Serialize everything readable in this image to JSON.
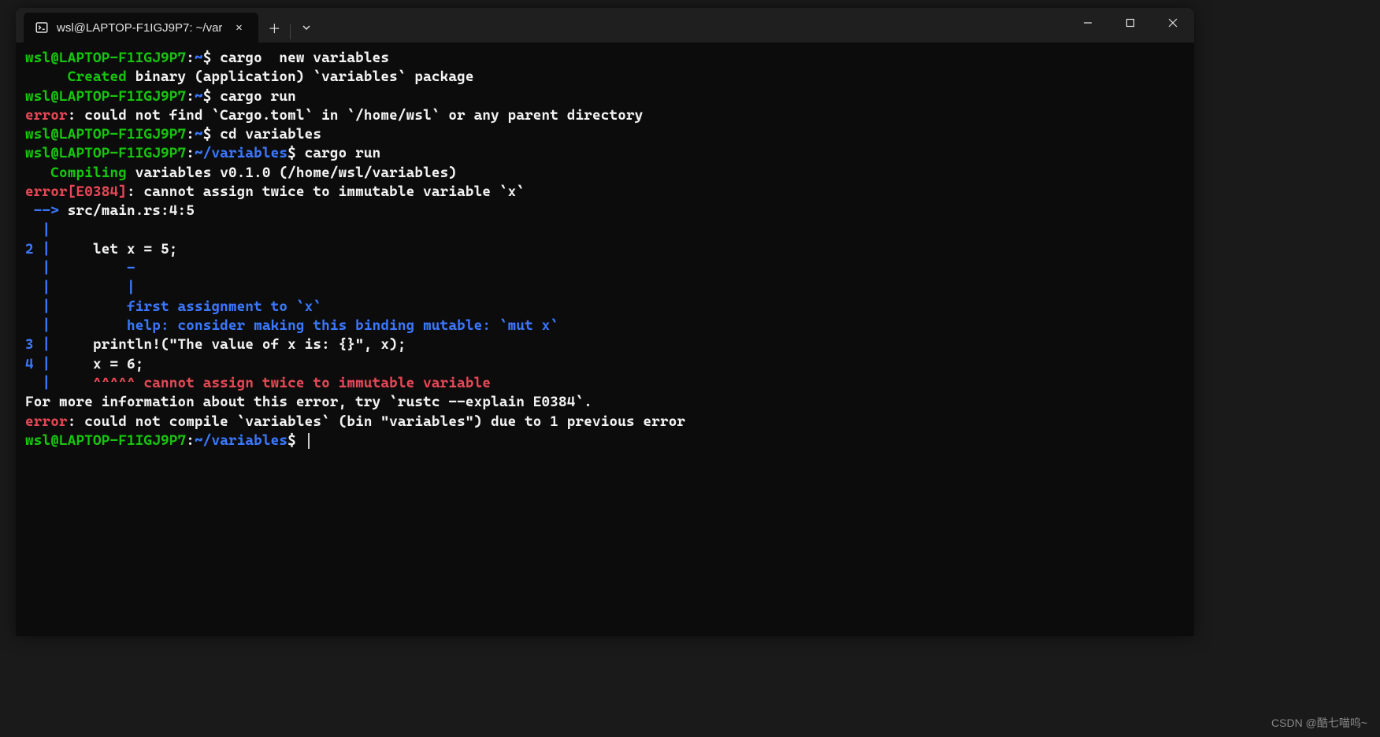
{
  "tab": {
    "title": "wsl@LAPTOP-F1IGJ9P7: ~/var"
  },
  "lines": [
    {
      "segments": [
        {
          "cls": "green",
          "t": "wsl@LAPTOP-F1IGJ9P7"
        },
        {
          "cls": "white",
          "t": ":"
        },
        {
          "cls": "blue",
          "t": "~"
        },
        {
          "cls": "white",
          "t": "$ cargo  new variables"
        }
      ]
    },
    {
      "segments": [
        {
          "cls": "white",
          "t": "     "
        },
        {
          "cls": "green",
          "t": "Created"
        },
        {
          "cls": "white",
          "t": " binary (application) `variables` package"
        }
      ]
    },
    {
      "segments": [
        {
          "cls": "green",
          "t": "wsl@LAPTOP-F1IGJ9P7"
        },
        {
          "cls": "white",
          "t": ":"
        },
        {
          "cls": "blue",
          "t": "~"
        },
        {
          "cls": "white",
          "t": "$ cargo run"
        }
      ]
    },
    {
      "segments": [
        {
          "cls": "red",
          "t": "error"
        },
        {
          "cls": "white",
          "t": ": could not find `Cargo.toml` in `/home/wsl` or any parent directory"
        }
      ]
    },
    {
      "segments": [
        {
          "cls": "green",
          "t": "wsl@LAPTOP-F1IGJ9P7"
        },
        {
          "cls": "white",
          "t": ":"
        },
        {
          "cls": "blue",
          "t": "~"
        },
        {
          "cls": "white",
          "t": "$ cd variables"
        }
      ]
    },
    {
      "segments": [
        {
          "cls": "green",
          "t": "wsl@LAPTOP-F1IGJ9P7"
        },
        {
          "cls": "white",
          "t": ":"
        },
        {
          "cls": "blue",
          "t": "~/variables"
        },
        {
          "cls": "white",
          "t": "$ cargo run"
        }
      ]
    },
    {
      "segments": [
        {
          "cls": "white",
          "t": "   "
        },
        {
          "cls": "green",
          "t": "Compiling"
        },
        {
          "cls": "white",
          "t": " variables v0.1.0 (/home/wsl/variables)"
        }
      ]
    },
    {
      "segments": [
        {
          "cls": "red",
          "t": "error[E0384]"
        },
        {
          "cls": "white",
          "t": ": cannot assign twice to immutable variable `x`"
        }
      ]
    },
    {
      "segments": [
        {
          "cls": "blue",
          "t": " -->"
        },
        {
          "cls": "white",
          "t": " src/main.rs:4:5"
        }
      ]
    },
    {
      "segments": [
        {
          "cls": "blue",
          "t": "  |"
        }
      ]
    },
    {
      "segments": [
        {
          "cls": "blue",
          "t": "2 |"
        },
        {
          "cls": "white",
          "t": "     let x = 5;"
        }
      ]
    },
    {
      "segments": [
        {
          "cls": "blue",
          "t": "  |"
        },
        {
          "cls": "blue",
          "t": "         -"
        }
      ]
    },
    {
      "segments": [
        {
          "cls": "blue",
          "t": "  |"
        },
        {
          "cls": "blue",
          "t": "         |"
        }
      ]
    },
    {
      "segments": [
        {
          "cls": "blue",
          "t": "  |"
        },
        {
          "cls": "blue",
          "t": "         first assignment to `x`"
        }
      ]
    },
    {
      "segments": [
        {
          "cls": "blue",
          "t": "  |"
        },
        {
          "cls": "blue",
          "t": "         help: consider making this binding mutable: `mut x`"
        }
      ]
    },
    {
      "segments": [
        {
          "cls": "blue",
          "t": "3 |"
        },
        {
          "cls": "white",
          "t": "     println!(\"The value of x is: {}\", x);"
        }
      ]
    },
    {
      "segments": [
        {
          "cls": "blue",
          "t": "4 |"
        },
        {
          "cls": "white",
          "t": "     x = 6;"
        }
      ]
    },
    {
      "segments": [
        {
          "cls": "blue",
          "t": "  |"
        },
        {
          "cls": "red",
          "t": "     ^^^^^ cannot assign twice to immutable variable"
        }
      ]
    },
    {
      "segments": [
        {
          "cls": "white",
          "t": ""
        }
      ]
    },
    {
      "segments": [
        {
          "cls": "white",
          "t": "For more information about this error, try `rustc --explain E0384`."
        }
      ]
    },
    {
      "segments": [
        {
          "cls": "red",
          "t": "error"
        },
        {
          "cls": "white",
          "t": ": could not compile `variables` (bin \"variables\") due to 1 previous error"
        }
      ]
    },
    {
      "segments": [
        {
          "cls": "green",
          "t": "wsl@LAPTOP-F1IGJ9P7"
        },
        {
          "cls": "white",
          "t": ":"
        },
        {
          "cls": "blue",
          "t": "~/variables"
        },
        {
          "cls": "white",
          "t": "$ "
        }
      ],
      "cursor": true
    }
  ],
  "watermark": "CSDN @酷七喵呜~"
}
